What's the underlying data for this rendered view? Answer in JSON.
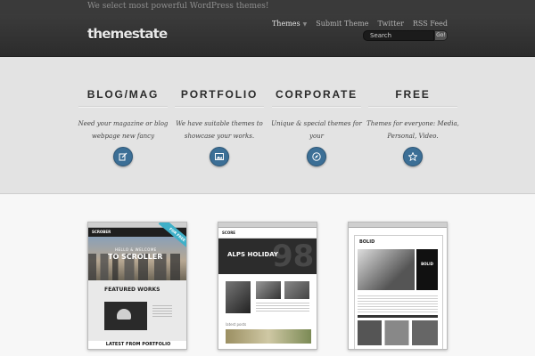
{
  "topbar": {
    "tagline": "We select most powerful WordPress themes!"
  },
  "header": {
    "logo": "themestate",
    "nav": [
      {
        "label": "Themes",
        "active": true,
        "has_dropdown": true
      },
      {
        "label": "Submit Theme"
      },
      {
        "label": "Twitter"
      },
      {
        "label": "RSS Feed"
      }
    ],
    "search": {
      "placeholder": "Search",
      "button": "Go!"
    }
  },
  "features": [
    {
      "title": "BLOG/MAG",
      "text": "Need your magazine or blog webpage new fancy",
      "icon": "edit-icon"
    },
    {
      "title": "PORTFOLIO",
      "text": "We have suitable themes to showcase your works.",
      "icon": "picture-icon"
    },
    {
      "title": "CORPORATE",
      "text": "Unique & special themes for your",
      "icon": "compass-icon"
    },
    {
      "title": "FREE",
      "text": "Themes for everyone: Media, Personal, Video.",
      "icon": "star-icon"
    }
  ],
  "colors": {
    "accent": "#3c6f96",
    "header_bg": "#333333",
    "band_bg": "#e3e3e3"
  },
  "thumbnails": [
    {
      "brand": "SCROBER",
      "ribbon": "FOR FREE",
      "hero_small": "HELLO & WELCOME",
      "hero_big": "TO SCROLLER",
      "featured": "FEATURED WORKS",
      "latest": "LATEST FROM PORTFOLIO"
    },
    {
      "brand": "SCORE",
      "hero_title": "ALPS HOLIDAY",
      "hero_number": "98",
      "posts": "latest posts"
    },
    {
      "brand": "BOLID",
      "side": "BOLID"
    }
  ]
}
